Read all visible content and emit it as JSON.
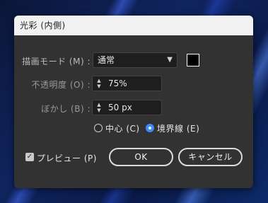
{
  "dialog": {
    "title": "光彩 (内側)",
    "blend_mode": {
      "label": "描画モード (M) :",
      "value": "通常",
      "swatch_color": "#000000"
    },
    "opacity": {
      "label": "不透明度 (O) :",
      "value": "75%"
    },
    "blur": {
      "label": "ぼかし (B) :",
      "value": "50 px"
    },
    "source": {
      "center_label": "中心 (C)",
      "edge_label": "境界線 (E)",
      "selected": "edge"
    },
    "preview": {
      "label": "プレビュー (P)",
      "checked": true
    },
    "ok_label": "OK",
    "cancel_label": "キャンセル"
  }
}
